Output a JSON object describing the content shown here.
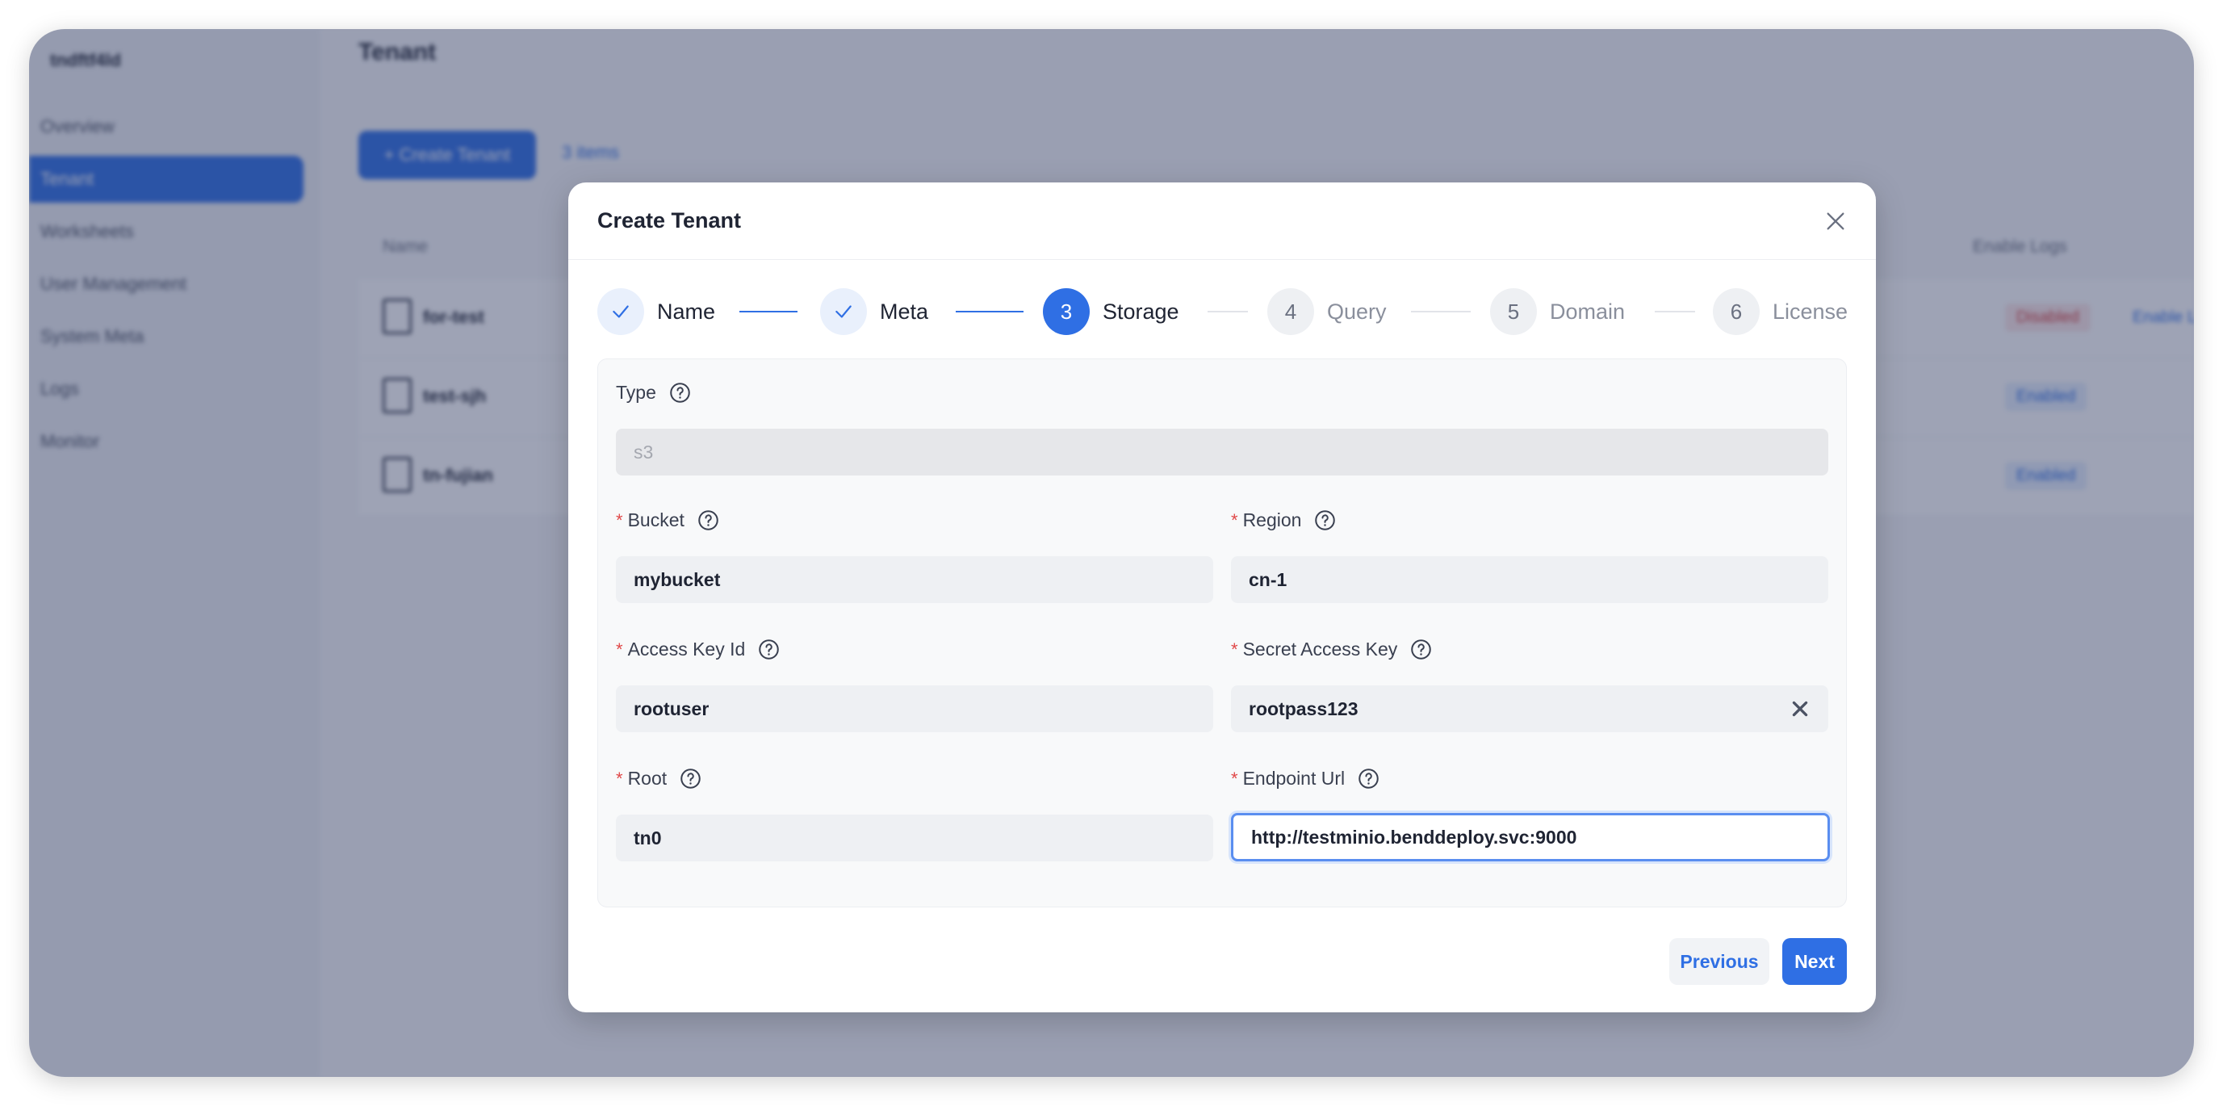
{
  "background": {
    "brand": "tndftf4ld",
    "page_title": "Tenant",
    "nav_items": [
      {
        "label": "Overview"
      },
      {
        "label": "Tenant"
      },
      {
        "label": "Worksheets"
      },
      {
        "label": "User Management"
      },
      {
        "label": "System Meta"
      },
      {
        "label": "Logs"
      },
      {
        "label": "Monitor"
      }
    ],
    "create_button": "+ Create Tenant",
    "items_link": "3 items",
    "table": {
      "col_name": "Name",
      "col_logs": "Enable Logs",
      "rows": [
        {
          "name": "for-test",
          "status": "Disabled",
          "action": "Enable Logs"
        },
        {
          "name": "test-sjh",
          "status": "Enabled",
          "action": ""
        },
        {
          "name": "tn-fujian",
          "status": "Enabled",
          "action": ""
        }
      ]
    }
  },
  "modal": {
    "title": "Create Tenant",
    "steps": [
      {
        "number": "1",
        "label": "Name",
        "state": "done"
      },
      {
        "number": "2",
        "label": "Meta",
        "state": "done"
      },
      {
        "number": "3",
        "label": "Storage",
        "state": "active"
      },
      {
        "number": "4",
        "label": "Query",
        "state": "todo"
      },
      {
        "number": "5",
        "label": "Domain",
        "state": "todo"
      },
      {
        "number": "6",
        "label": "License",
        "state": "todo"
      }
    ],
    "form": {
      "type": {
        "label": "Type",
        "value": "s3"
      },
      "bucket": {
        "label": "Bucket",
        "value": "mybucket"
      },
      "region": {
        "label": "Region",
        "value": "cn-1"
      },
      "access_key_id": {
        "label": "Access Key Id",
        "value": "rootuser"
      },
      "secret_access_key": {
        "label": "Secret Access Key",
        "value": "rootpass123"
      },
      "root": {
        "label": "Root",
        "value": "tn0"
      },
      "endpoint_url": {
        "label": "Endpoint Url",
        "value": "http://testminio.benddeploy.svc:9000"
      }
    },
    "buttons": {
      "previous": "Previous",
      "next": "Next"
    }
  },
  "colors": {
    "accent": "#2f6fe4",
    "required": "#e04848",
    "overlay": "#28345a"
  }
}
